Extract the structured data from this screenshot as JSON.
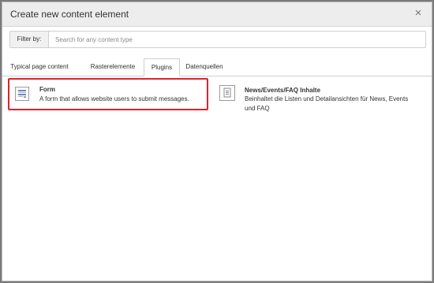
{
  "dialog": {
    "title": "Create new content element",
    "close_glyph": "×"
  },
  "filter": {
    "label": "Filter by:",
    "placeholder": "Search for any content type",
    "value": ""
  },
  "tabs": [
    {
      "label": "Typical page content",
      "active": false
    },
    {
      "label": "Rasterelemente",
      "active": false
    },
    {
      "label": "Plugins",
      "active": true
    },
    {
      "label": "Datenquellen",
      "active": false
    }
  ],
  "items": [
    {
      "title": "Form",
      "description": "A form that allows website users to submit messages.",
      "icon": "form-icon",
      "highlighted": true
    },
    {
      "title": "News/Events/FAQ Inhalte",
      "description": "Beinhaltet die Listen und Detailansichten für News, Events und FAQ",
      "icon": "document-icon",
      "highlighted": false
    }
  ],
  "colors": {
    "highlight": "#e2202a",
    "header_bg": "#ededed",
    "icon_accent": "#6b83c4"
  }
}
